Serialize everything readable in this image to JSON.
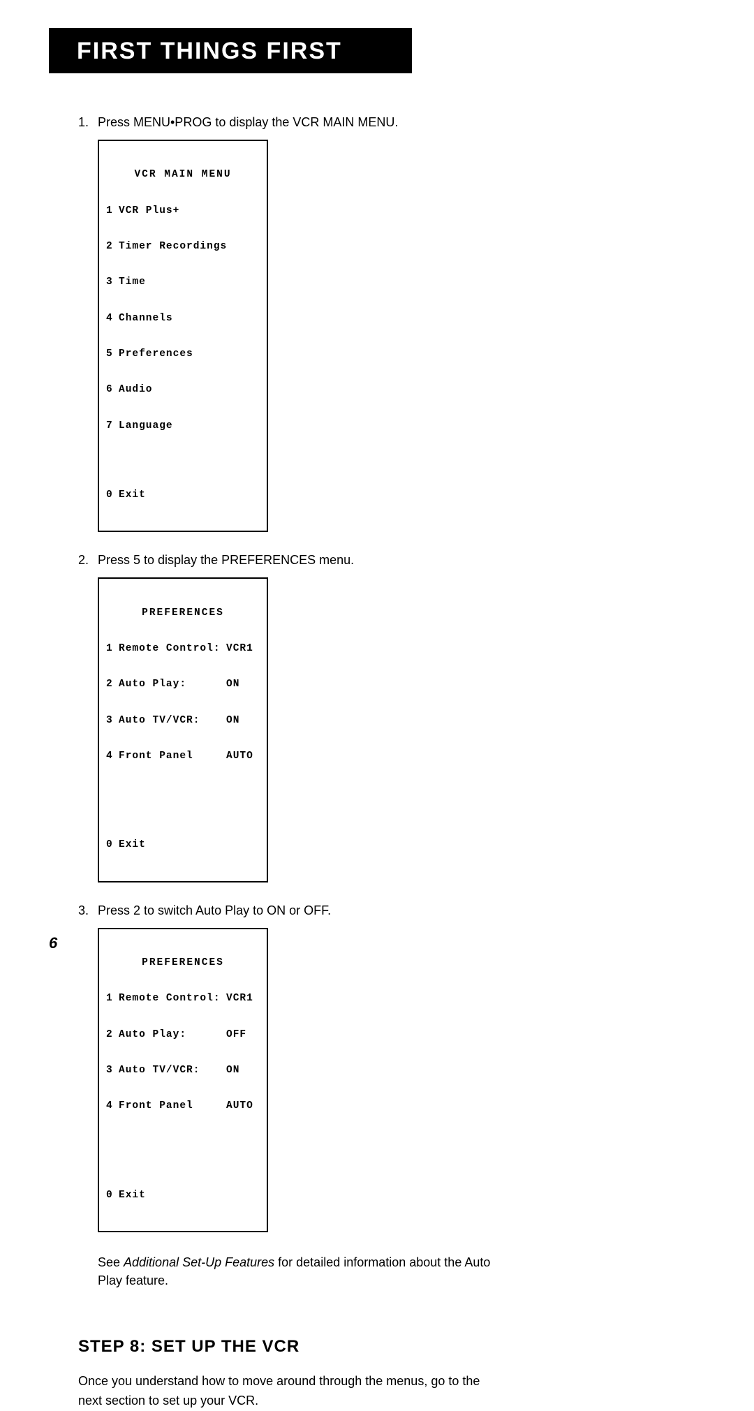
{
  "banner": "FIRST THINGS FIRST",
  "steps": [
    {
      "num": "1.",
      "text": "Press MENU•PROG to display the VCR MAIN MENU."
    },
    {
      "num": "2.",
      "text": "Press 5 to display the PREFERENCES menu."
    },
    {
      "num": "3.",
      "text": "Press 2 to switch Auto Play to ON or OFF."
    }
  ],
  "menu1": {
    "title": "VCR MAIN MENU",
    "items": [
      {
        "n": "1",
        "label": "VCR Plus+"
      },
      {
        "n": "2",
        "label": "Timer Recordings"
      },
      {
        "n": "3",
        "label": "Time"
      },
      {
        "n": "4",
        "label": "Channels"
      },
      {
        "n": "5",
        "label": "Preferences"
      },
      {
        "n": "6",
        "label": "Audio"
      },
      {
        "n": "7",
        "label": "Language"
      }
    ],
    "exit": {
      "n": "0",
      "label": "Exit"
    }
  },
  "menu2": {
    "title": "PREFERENCES",
    "items": [
      {
        "n": "1",
        "label": "Remote Control:",
        "value": "VCR1"
      },
      {
        "n": "2",
        "label": "Auto Play:",
        "value": "ON"
      },
      {
        "n": "3",
        "label": "Auto TV/VCR:",
        "value": "ON"
      },
      {
        "n": "4",
        "label": "Front Panel",
        "value": "AUTO"
      }
    ],
    "exit": {
      "n": "0",
      "label": "Exit"
    }
  },
  "menu3": {
    "title": "PREFERENCES",
    "items": [
      {
        "n": "1",
        "label": "Remote Control:",
        "value": "VCR1"
      },
      {
        "n": "2",
        "label": "Auto Play:",
        "value": "OFF"
      },
      {
        "n": "3",
        "label": "Auto TV/VCR:",
        "value": "ON"
      },
      {
        "n": "4",
        "label": "Front Panel",
        "value": "AUTO"
      }
    ],
    "exit": {
      "n": "0",
      "label": "Exit"
    }
  },
  "note_prefix": "See ",
  "note_italic": "Additional Set-Up Features",
  "note_suffix": " for detailed information about the Auto Play feature.",
  "section_heading": "STEP 8: SET UP THE VCR",
  "body": "Once you understand how to move around through the menus, go to the next section to set up your VCR.",
  "page_number": "6"
}
